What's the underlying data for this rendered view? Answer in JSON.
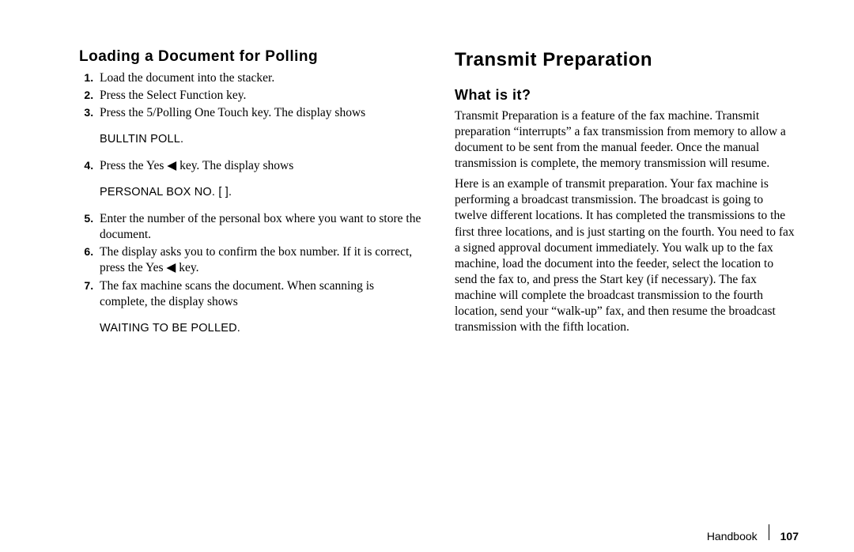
{
  "left": {
    "heading": "Loading a Document for Polling",
    "step1": "Load the document into the stacker.",
    "step2": "Press the Select Function key.",
    "step3": "Press the 5/Polling One Touch key. The display shows",
    "display1": "BULLTIN POLL.",
    "step4a": "Press the Yes ",
    "step4b": " key. The display shows",
    "display2": "PERSONAL BOX NO. [ ].",
    "step5": "Enter the number of the personal box where you want to store the document.",
    "step6a": "The display asks you to confirm the box number. If it is correct, press the Yes ",
    "step6b": " key.",
    "step7": "The fax machine scans the document. When scanning is complete, the display shows",
    "display3": "WAITING TO BE POLLED."
  },
  "right": {
    "heading": "Transmit Preparation",
    "sub": "What is it?",
    "p1": "Transmit Preparation is a feature of the fax machine. Transmit preparation “interrupts” a fax transmission from memory to allow a document to be sent from the manual feeder. Once the manual transmission is complete, the memory transmission will resume.",
    "p2": "Here is an example of transmit preparation. Your fax machine is performing a broadcast transmission. The broadcast is going to twelve different locations. It has completed the transmissions to the first three locations, and is just starting on the fourth. You need to fax a signed approval document immediately. You walk up to the fax machine, load the document into the feeder, select the location to send the fax to, and press the Start key (if necessary). The fax machine will complete the broadcast transmission to the fourth location, send your “walk-up” fax, and then resume the broadcast transmission with the fifth location."
  },
  "footer": {
    "label": "Handbook",
    "page": "107"
  }
}
